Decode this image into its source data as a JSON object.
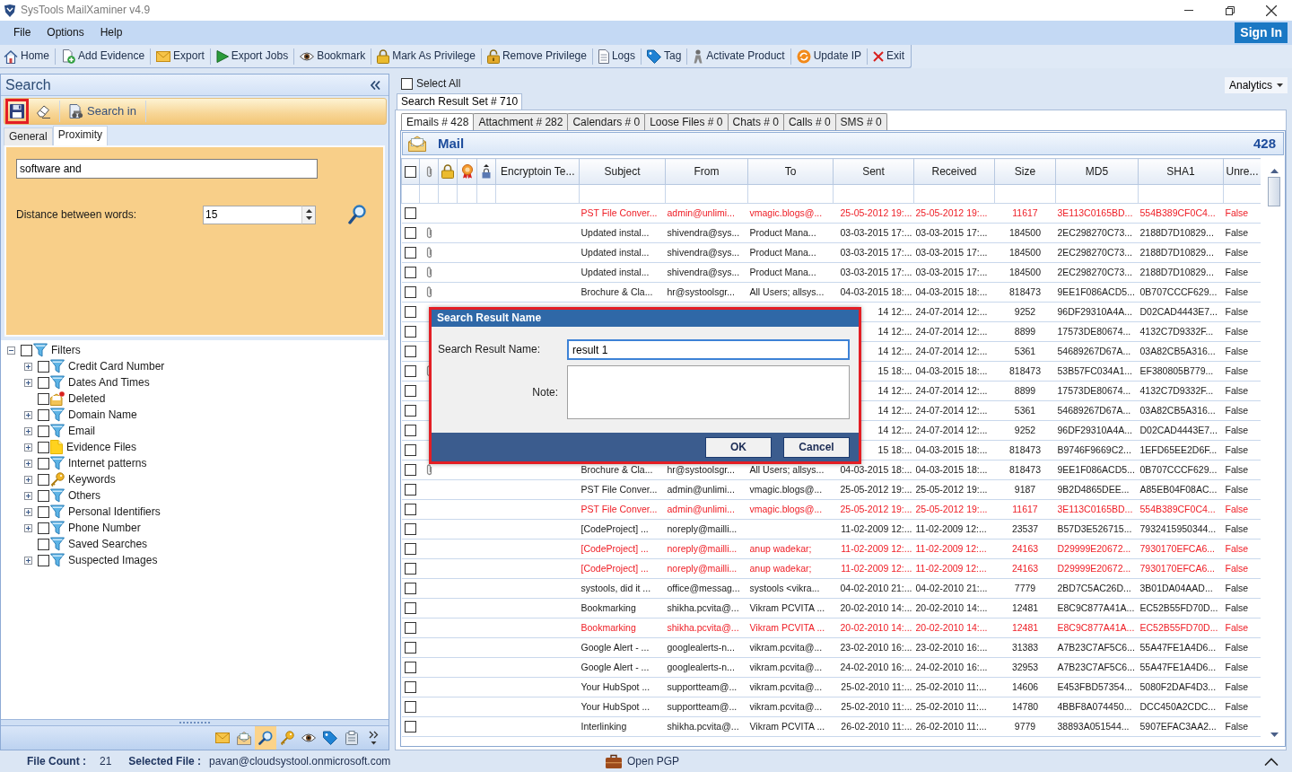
{
  "window": {
    "title": "SysTools MailXaminer v4.9"
  },
  "menu": [
    {
      "label": "File"
    },
    {
      "label": "Options"
    },
    {
      "label": "Help"
    }
  ],
  "sign_in": {
    "label": "Sign In"
  },
  "toolbar": [
    {
      "kind": "home",
      "label": "Home"
    },
    {
      "kind": "add-evidence",
      "label": "Add Evidence"
    },
    {
      "kind": "export",
      "label": "Export"
    },
    {
      "kind": "export-jobs",
      "label": "Export Jobs"
    },
    {
      "kind": "bookmark",
      "label": "Bookmark"
    },
    {
      "kind": "mark-privilege",
      "label": "Mark As Privilege"
    },
    {
      "kind": "remove-privilege",
      "label": "Remove Privilege"
    },
    {
      "kind": "logs",
      "label": "Logs"
    },
    {
      "kind": "tag",
      "label": "Tag"
    },
    {
      "kind": "activate-product",
      "label": "Activate Product"
    },
    {
      "kind": "update-ip",
      "label": "Update IP"
    },
    {
      "kind": "exit",
      "label": "Exit"
    }
  ],
  "search_panel": {
    "title": "Search",
    "tools": [
      {
        "kind": "save",
        "highlighted": true
      },
      {
        "kind": "eraser",
        "highlighted": false
      },
      {
        "kind": "search-in",
        "label": "Search in",
        "highlighted": false
      }
    ],
    "tabs": [
      {
        "label": "General",
        "selected": false
      },
      {
        "label": "Proximity",
        "selected": true
      }
    ],
    "query": {
      "value": "software and"
    },
    "distance": {
      "label": "Distance between words:",
      "value": "15"
    }
  },
  "filters": [
    {
      "label": "Filters",
      "kind": "filter",
      "checked": false,
      "expanded": true,
      "children": [
        {
          "label": "Credit Card Number",
          "kind": "filter",
          "checked": false,
          "expanded": false
        },
        {
          "label": "Dates And Times",
          "kind": "filter",
          "checked": false,
          "expanded": false
        },
        {
          "label": "Deleted",
          "kind": "deleted",
          "checked": false
        },
        {
          "label": "Domain Name",
          "kind": "filter",
          "checked": false,
          "expanded": false
        },
        {
          "label": "Email",
          "kind": "filter",
          "checked": false,
          "expanded": false
        },
        {
          "label": "Evidence Files",
          "kind": "file",
          "checked": false,
          "expanded": false
        },
        {
          "label": "Internet patterns",
          "kind": "filter",
          "checked": false,
          "expanded": false
        },
        {
          "label": "Keywords",
          "kind": "key",
          "checked": false,
          "expanded": false
        },
        {
          "label": "Others",
          "kind": "filter",
          "checked": false,
          "expanded": false
        },
        {
          "label": "Personal Identifiers",
          "kind": "filter",
          "checked": false,
          "expanded": false
        },
        {
          "label": "Phone Number",
          "kind": "filter",
          "checked": false,
          "expanded": false
        },
        {
          "label": "Saved Searches",
          "kind": "filter",
          "checked": false
        },
        {
          "label": "Suspected Images",
          "kind": "filter",
          "checked": false,
          "expanded": false
        }
      ]
    }
  ],
  "side_nav": [
    {
      "kind": "mail",
      "selected": false
    },
    {
      "kind": "open-mail",
      "selected": false
    },
    {
      "kind": "search",
      "selected": true
    },
    {
      "kind": "key",
      "selected": false
    },
    {
      "kind": "eye",
      "selected": false
    },
    {
      "kind": "tag",
      "selected": false
    },
    {
      "kind": "clipboard",
      "selected": false
    },
    {
      "kind": "more",
      "selected": false
    }
  ],
  "results": {
    "select_all": {
      "label": "Select All",
      "checked": false
    },
    "analytics": {
      "label": "Analytics"
    },
    "result_tabs": [
      {
        "label": "Search Result Set # 710",
        "selected": true
      }
    ],
    "type_tabs": [
      {
        "label": "Emails # 428",
        "selected": true
      },
      {
        "label": "Attachment # 282",
        "selected": false
      },
      {
        "label": "Calendars # 0",
        "selected": false
      },
      {
        "label": "Loose Files # 0",
        "selected": false
      },
      {
        "label": "Chats # 0",
        "selected": false
      },
      {
        "label": "Calls # 0",
        "selected": false
      },
      {
        "label": "SMS # 0",
        "selected": false
      }
    ],
    "grid_title": "Mail",
    "grid_count": "428",
    "header_checkbox": {
      "checked": false
    },
    "columns": [
      "Encryptoin Te...",
      "Subject",
      "From",
      "To",
      "Sent",
      "Received",
      "Size",
      "MD5",
      "SHA1",
      "Unre..."
    ],
    "rows": [
      {
        "checked": false,
        "highlighted": true,
        "has_attachment": false,
        "subject": "PST File Conver...",
        "from": "admin@unlimi...",
        "to": "vmagic.blogs@...",
        "sent": "25-05-2012 19:...",
        "received": "25-05-2012 19:...",
        "size": "11617",
        "md5": "3E113C0165BD...",
        "sha1": "554B389CF0C4...",
        "unread": "False"
      },
      {
        "checked": false,
        "highlighted": false,
        "has_attachment": true,
        "subject": "Updated instal...",
        "from": "shivendra@sys...",
        "to": "Product Mana...",
        "sent": "03-03-2015 17:...",
        "received": "03-03-2015 17:...",
        "size": "184500",
        "md5": "2EC298270C73...",
        "sha1": "2188D7D10829...",
        "unread": "False"
      },
      {
        "checked": false,
        "highlighted": false,
        "has_attachment": true,
        "subject": "Updated instal...",
        "from": "shivendra@sys...",
        "to": "Product Mana...",
        "sent": "03-03-2015 17:...",
        "received": "03-03-2015 17:...",
        "size": "184500",
        "md5": "2EC298270C73...",
        "sha1": "2188D7D10829...",
        "unread": "False"
      },
      {
        "checked": false,
        "highlighted": false,
        "has_attachment": true,
        "subject": "Updated instal...",
        "from": "shivendra@sys...",
        "to": "Product Mana...",
        "sent": "03-03-2015 17:...",
        "received": "03-03-2015 17:...",
        "size": "184500",
        "md5": "2EC298270C73...",
        "sha1": "2188D7D10829...",
        "unread": "False"
      },
      {
        "checked": false,
        "highlighted": false,
        "has_attachment": true,
        "subject": "Brochure & Cla...",
        "from": "hr@systoolsgr...",
        "to": "All Users; allsys...",
        "sent": "04-03-2015 18:...",
        "received": "04-03-2015 18:...",
        "size": "818473",
        "md5": "9EE1F086ACD5...",
        "sha1": "0B707CCCF629...",
        "unread": "False"
      },
      {
        "checked": false,
        "highlighted": false,
        "has_attachment": false,
        "sent": "14 12:...",
        "received": "24-07-2014 12:...",
        "size": "9252",
        "md5": "96DF29310A4A...",
        "sha1": "D02CAD4443E7...",
        "unread": "False"
      },
      {
        "checked": false,
        "highlighted": false,
        "has_attachment": false,
        "sent": "14 12:...",
        "received": "24-07-2014 12:...",
        "size": "8899",
        "md5": "17573DE80674...",
        "sha1": "4132C7D9332F...",
        "unread": "False"
      },
      {
        "checked": false,
        "highlighted": false,
        "has_attachment": false,
        "sent": "14 12:...",
        "received": "24-07-2014 12:...",
        "size": "5361",
        "md5": "54689267D67A...",
        "sha1": "03A82CB5A316...",
        "unread": "False"
      },
      {
        "checked": false,
        "highlighted": false,
        "has_attachment": true,
        "sent": "15 18:...",
        "received": "04-03-2015 18:...",
        "size": "818473",
        "md5": "53B57FC034A1...",
        "sha1": "EF380805B779...",
        "unread": "False"
      },
      {
        "checked": false,
        "highlighted": false,
        "has_attachment": false,
        "sent": "14 12:...",
        "received": "24-07-2014 12:...",
        "size": "8899",
        "md5": "17573DE80674...",
        "sha1": "4132C7D9332F...",
        "unread": "False"
      },
      {
        "checked": false,
        "highlighted": false,
        "has_attachment": false,
        "sent": "14 12:...",
        "received": "24-07-2014 12:...",
        "size": "5361",
        "md5": "54689267D67A...",
        "sha1": "03A82CB5A316...",
        "unread": "False"
      },
      {
        "checked": false,
        "highlighted": false,
        "has_attachment": false,
        "sent": "14 12:...",
        "received": "24-07-2014 12:...",
        "size": "9252",
        "md5": "96DF29310A4A...",
        "sha1": "D02CAD4443E7...",
        "unread": "False"
      },
      {
        "checked": false,
        "highlighted": false,
        "has_attachment": false,
        "sent": "15 18:...",
        "received": "04-03-2015 18:...",
        "size": "818473",
        "md5": "B9746F9669C2...",
        "sha1": "1EFD65EE2D6F...",
        "unread": "False"
      },
      {
        "checked": false,
        "highlighted": false,
        "has_attachment": true,
        "subject": "Brochure & Cla...",
        "from": "hr@systoolsgr...",
        "to": "All Users; allsys...",
        "sent": "04-03-2015 18:...",
        "received": "04-03-2015 18:...",
        "size": "818473",
        "md5": "9EE1F086ACD5...",
        "sha1": "0B707CCCF629...",
        "unread": "False"
      },
      {
        "checked": false,
        "highlighted": false,
        "has_attachment": false,
        "subject": "PST File Conver...",
        "from": "admin@unlimi...",
        "to": "vmagic.blogs@...",
        "sent": "25-05-2012 19:...",
        "received": "25-05-2012 19:...",
        "size": "9187",
        "md5": "9B2D4865DEE...",
        "sha1": "A85EB04F08AC...",
        "unread": "False"
      },
      {
        "checked": false,
        "highlighted": true,
        "has_attachment": false,
        "subject": "PST File Conver...",
        "from": "admin@unlimi...",
        "to": "vmagic.blogs@...",
        "sent": "25-05-2012 19:...",
        "received": "25-05-2012 19:...",
        "size": "11617",
        "md5": "3E113C0165BD...",
        "sha1": "554B389CF0C4...",
        "unread": "False"
      },
      {
        "checked": false,
        "highlighted": false,
        "has_attachment": false,
        "subject": "[CodeProject] ...",
        "from": "noreply@mailli...",
        "sent": "11-02-2009 12:...",
        "received": "11-02-2009 12:...",
        "size": "23537",
        "md5": "B57D3E526715...",
        "sha1": "7932415950344...",
        "unread": "False"
      },
      {
        "checked": false,
        "highlighted": true,
        "has_attachment": false,
        "subject": "[CodeProject] ...",
        "from": "noreply@mailli...",
        "to": "anup wadekar;",
        "sent": "11-02-2009 12:...",
        "received": "11-02-2009 12:...",
        "size": "24163",
        "md5": "D29999E20672...",
        "sha1": "7930170EFCA6...",
        "unread": "False"
      },
      {
        "checked": false,
        "highlighted": true,
        "has_attachment": false,
        "subject": "[CodeProject] ...",
        "from": "noreply@mailli...",
        "to": "anup wadekar;",
        "sent": "11-02-2009 12:...",
        "received": "11-02-2009 12:...",
        "size": "24163",
        "md5": "D29999E20672...",
        "sha1": "7930170EFCA6...",
        "unread": "False"
      },
      {
        "checked": false,
        "highlighted": false,
        "has_attachment": false,
        "subject": "systools, did it ...",
        "from": "office@messag...",
        "to": "systools <vikra...",
        "sent": "04-02-2010 21:...",
        "received": "04-02-2010 21:...",
        "size": "7779",
        "md5": "2BD7C5AC26D...",
        "sha1": "3B01DA04AAD...",
        "unread": "False"
      },
      {
        "checked": false,
        "highlighted": false,
        "has_attachment": false,
        "subject": "Bookmarking",
        "from": "shikha.pcvita@...",
        "to": "Vikram PCVITA ...",
        "sent": "20-02-2010 14:...",
        "received": "20-02-2010 14:...",
        "size": "12481",
        "md5": "E8C9C877A41A...",
        "sha1": "EC52B55FD70D...",
        "unread": "False"
      },
      {
        "checked": false,
        "highlighted": true,
        "has_attachment": false,
        "subject": "Bookmarking",
        "from": "shikha.pcvita@...",
        "to": "Vikram PCVITA ...",
        "sent": "20-02-2010 14:...",
        "received": "20-02-2010 14:...",
        "size": "12481",
        "md5": "E8C9C877A41A...",
        "sha1": "EC52B55FD70D...",
        "unread": "False"
      },
      {
        "checked": false,
        "highlighted": false,
        "has_attachment": false,
        "subject": "Google Alert - ...",
        "from": "googlealerts-n...",
        "to": "vikram.pcvita@...",
        "sent": "23-02-2010 16:...",
        "received": "23-02-2010 16:...",
        "size": "31383",
        "md5": "A7B23C7AF5C6...",
        "sha1": "55A47FE1A4D6...",
        "unread": "False"
      },
      {
        "checked": false,
        "highlighted": false,
        "has_attachment": false,
        "subject": "Google Alert - ...",
        "from": "googlealerts-n...",
        "to": "vikram.pcvita@...",
        "sent": "24-02-2010 16:...",
        "received": "24-02-2010 16:...",
        "size": "32953",
        "md5": "A7B23C7AF5C6...",
        "sha1": "55A47FE1A4D6...",
        "unread": "False"
      },
      {
        "checked": false,
        "highlighted": false,
        "has_attachment": false,
        "subject": "Your HubSpot ...",
        "from": "supportteam@...",
        "to": "vikram.pcvita@...",
        "sent": "25-02-2010 11:...",
        "received": "25-02-2010 11:...",
        "size": "14606",
        "md5": "E453FBD57354...",
        "sha1": "5080F2DAF4D3...",
        "unread": "False"
      },
      {
        "checked": false,
        "highlighted": false,
        "has_attachment": false,
        "subject": "Your HubSpot ...",
        "from": "supportteam@...",
        "to": "vikram.pcvita@...",
        "sent": "25-02-2010 11:...",
        "received": "25-02-2010 11:...",
        "size": "14780",
        "md5": "4BBF8A074450...",
        "sha1": "DCC450A2CDC...",
        "unread": "False"
      },
      {
        "checked": false,
        "highlighted": false,
        "has_attachment": false,
        "subject": "Interlinking",
        "from": "shikha.pcvita@...",
        "to": "Vikram PCVITA ...",
        "sent": "26-02-2010 11:...",
        "received": "26-02-2010 11:...",
        "size": "9779",
        "md5": "38893A051544...",
        "sha1": "5907EFAC3AA2...",
        "unread": "False"
      }
    ]
  },
  "dialog": {
    "title": "Search Result Name",
    "highlighted": true,
    "fields": [
      {
        "kind": "input",
        "label": "Search Result Name:",
        "value": "result 1",
        "focused": true
      },
      {
        "kind": "textarea",
        "label": "Note:",
        "focused": false
      }
    ],
    "buttons": [
      {
        "label": "OK"
      },
      {
        "label": "Cancel"
      }
    ]
  },
  "status_bar": {
    "file_count_label": "File Count :",
    "file_count": "21",
    "selected_file_label": "Selected File :",
    "selected_file": "pavan@cloudsystool.onmicrosoft.com",
    "open_pgp": {
      "label": "Open PGP"
    }
  }
}
